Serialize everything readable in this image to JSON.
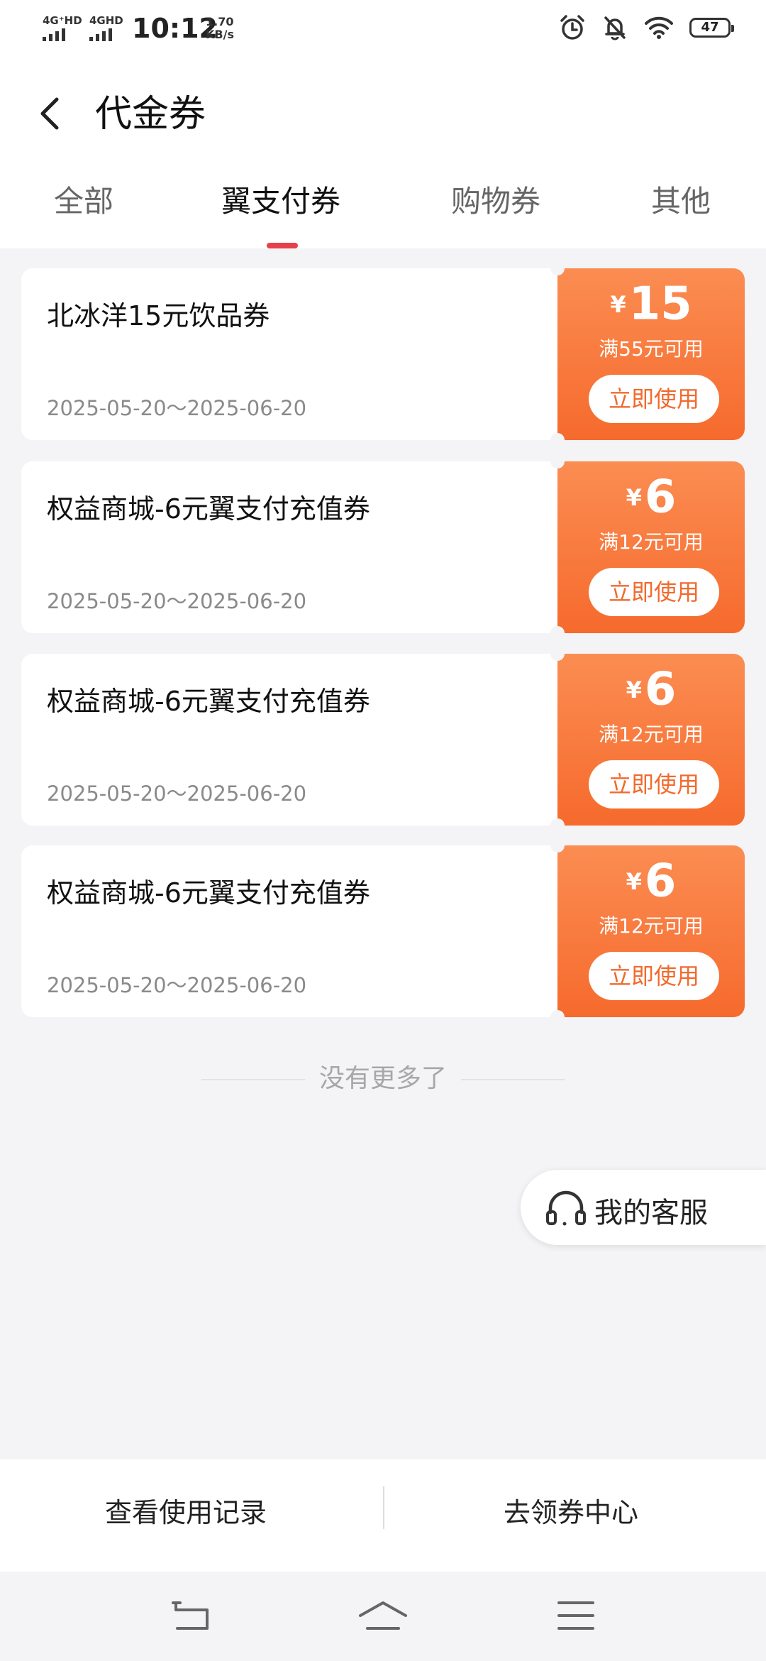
{
  "status_bar": {
    "signal1": "4G⁺HD",
    "signal2": "4GHD",
    "time": "10:12",
    "speed_value": "1.70",
    "speed_unit": "KB/s",
    "battery": "47"
  },
  "header": {
    "title": "代金券"
  },
  "tabs": [
    {
      "label": "全部"
    },
    {
      "label": "翼支付券"
    },
    {
      "label": "购物券"
    },
    {
      "label": "其他"
    }
  ],
  "active_tab_index": 1,
  "coupons": [
    {
      "name": "北冰洋15元饮品券",
      "date": "2025-05-20～2025-06-20",
      "yen": "¥",
      "amount": "15",
      "condition": "满55元可用",
      "button": "立即使用"
    },
    {
      "name": "权益商城-6元翼支付充值券",
      "date": "2025-05-20～2025-06-20",
      "yen": "¥",
      "amount": "6",
      "condition": "满12元可用",
      "button": "立即使用"
    },
    {
      "name": "权益商城-6元翼支付充值券",
      "date": "2025-05-20～2025-06-20",
      "yen": "¥",
      "amount": "6",
      "condition": "满12元可用",
      "button": "立即使用"
    },
    {
      "name": "权益商城-6元翼支付充值券",
      "date": "2025-05-20～2025-06-20",
      "yen": "¥",
      "amount": "6",
      "condition": "满12元可用",
      "button": "立即使用"
    }
  ],
  "list_end_text": "没有更多了",
  "service": {
    "label": "我的客服",
    "icon": "headset-icon"
  },
  "bottom_bar": {
    "left": "查看使用记录",
    "right": "去领券中心"
  },
  "colors": {
    "accent": "#e8404a",
    "coupon_orange": "#f66a2d",
    "background": "#f4f4f6"
  }
}
